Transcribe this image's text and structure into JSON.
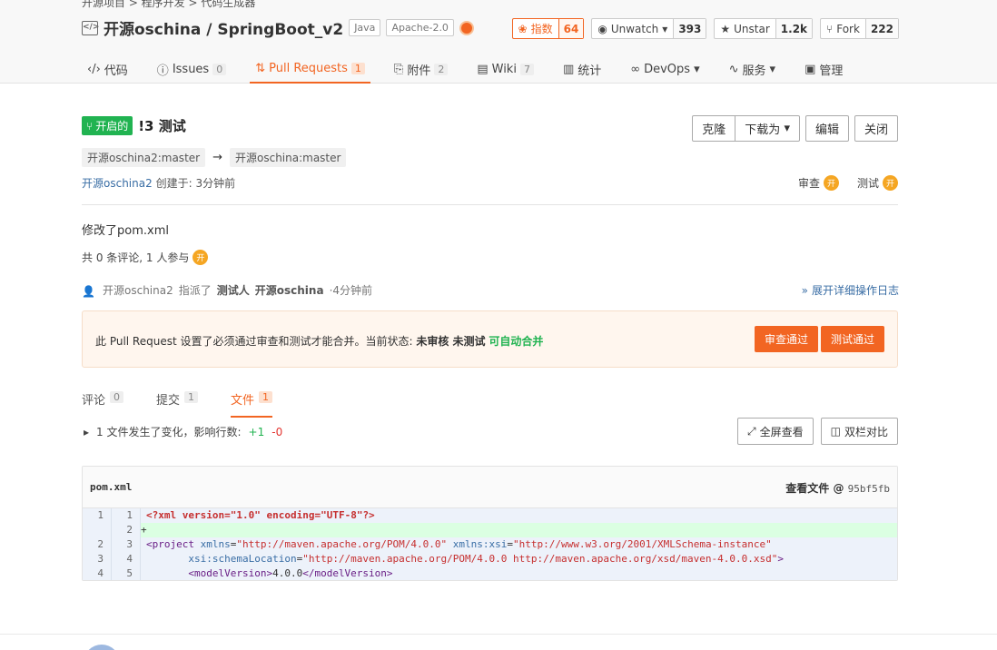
{
  "breadcrumb": "开源项目 > 程序开发 > 代码生成器",
  "repo": {
    "title": "开源oschina / SpringBoot_v2",
    "tags": [
      "Java",
      "Apache-2.0"
    ]
  },
  "stats": {
    "index_label": "指数",
    "index_value": "64",
    "watch_label": "Unwatch",
    "watch_value": "393",
    "star_label": "Unstar",
    "star_value": "1.2k",
    "fork_label": "Fork",
    "fork_value": "222"
  },
  "tabs": [
    {
      "label": "代码",
      "count": ""
    },
    {
      "label": "Issues",
      "count": "0"
    },
    {
      "label": "Pull Requests",
      "count": "1"
    },
    {
      "label": "附件",
      "count": "2"
    },
    {
      "label": "Wiki",
      "count": "7"
    },
    {
      "label": "统计",
      "count": ""
    },
    {
      "label": "DevOps",
      "count": ""
    },
    {
      "label": "服务",
      "count": ""
    },
    {
      "label": "管理",
      "count": ""
    }
  ],
  "pr": {
    "status": "开启的",
    "title": "!3 测试",
    "source_branch": "开源oschina2:master",
    "arrow": "→",
    "target_branch": "开源oschina:master",
    "author": "开源oschina2",
    "created_label": "创建于:",
    "created_time": "3分钟前",
    "reviewer_label": "审查",
    "tester_label": "测试",
    "avatar_char": "开",
    "description": "修改了pom.xml",
    "comment_summary": "共 0 条评论, 1 人参与"
  },
  "actions": {
    "clone": "克隆",
    "download": "下载为",
    "edit": "编辑",
    "close": "关闭"
  },
  "activity": {
    "actor": "开源oschina2",
    "verb": "指派了",
    "role": "测试人",
    "target": "开源oschina",
    "time": "·4分钟前",
    "expand_log": "展开详细操作日志"
  },
  "notice": {
    "text": "此 Pull Request 设置了必须通过审查和测试才能合并。当前状态:",
    "status1": "未审核 未测试",
    "status2": "可自动合并",
    "review_pass": "审查通过",
    "test_pass": "测试通过"
  },
  "subtabs": [
    {
      "label": "评论",
      "count": "0"
    },
    {
      "label": "提交",
      "count": "1"
    },
    {
      "label": "文件",
      "count": "1"
    }
  ],
  "changes": {
    "summary": "1 文件发生了变化，影响行数:",
    "plus": "+1",
    "minus": "-0",
    "fullscreen": "全屏查看",
    "split": "双栏对比"
  },
  "diff": {
    "filename": "pom.xml",
    "view_file_label": "查看文件 @",
    "commit": "95bf5fb",
    "lines": [
      {
        "old": "1",
        "new": "1",
        "type": "ctx"
      },
      {
        "old": "",
        "new": "2",
        "type": "add"
      },
      {
        "old": "2",
        "new": "3",
        "type": "ctx"
      },
      {
        "old": "3",
        "new": "4",
        "type": "ctx"
      },
      {
        "old": "4",
        "new": "5",
        "type": "ctx"
      }
    ]
  },
  "colors": {
    "accent": "#f26522",
    "open_green": "#21b351",
    "link_blue": "#3a6ea5"
  }
}
